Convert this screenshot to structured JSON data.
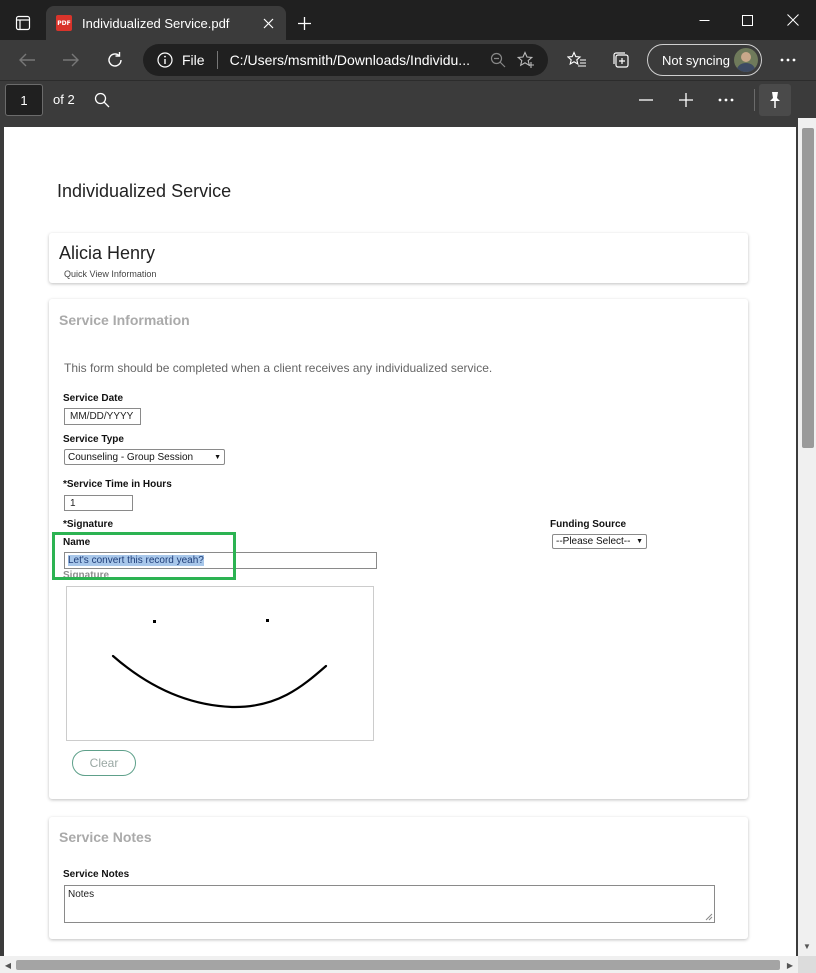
{
  "browser": {
    "tab_title": "Individualized Service.pdf",
    "favicon_text": "PDF",
    "address": {
      "scheme_label": "File",
      "url": "C:/Users/msmith/Downloads/Individu..."
    },
    "sync_label": "Not syncing"
  },
  "pdf_toolbar": {
    "page_number": "1",
    "page_count": "of 2"
  },
  "document": {
    "title": "Individualized Service",
    "client": {
      "name": "Alicia Henry",
      "subtitle": "Quick View Information"
    },
    "service_info": {
      "heading": "Service Information",
      "intro": "This form should be completed when a client receives any individualized service.",
      "service_date_label": "Service Date",
      "service_date_value": "MM/DD/YYYY",
      "service_type_label": "Service Type",
      "service_type_value": "Counseling - Group Session",
      "service_time_label": "*Service Time in Hours",
      "service_time_value": "1",
      "signature_label": "*Signature",
      "name_label": "Name",
      "name_value": "Let's convert this record yeah?",
      "signature_sub_label": "Signature",
      "clear_label": "Clear",
      "funding_label": "Funding Source",
      "funding_value": "--Please Select--"
    },
    "service_notes": {
      "heading": "Service Notes",
      "notes_label": "Service Notes",
      "notes_value": "Notes"
    }
  },
  "colors": {
    "highlight_box": "#2cb352",
    "selection": "#a8c7ea",
    "clear_border": "#5ea08a"
  }
}
